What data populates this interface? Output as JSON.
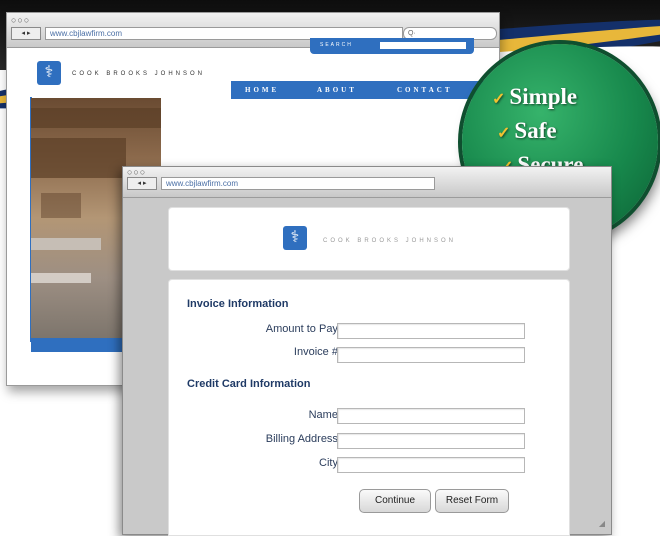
{
  "back_window": {
    "traffic": "○○○",
    "nav": "◂ ▸",
    "url": "www.cbjlawfirm.com",
    "search_placeholder": "Q·",
    "brand": "COOK BROOKS JOHNSON",
    "search_label": "SEARCH",
    "nav_items": [
      "HOME",
      "ABOUT",
      "CONTACT"
    ]
  },
  "badge": {
    "lines": [
      "Simple",
      "Safe",
      "Secure"
    ],
    "check": "✓"
  },
  "front_window": {
    "traffic": "○○○",
    "nav": "◂ ▸",
    "url": "www.cbjlawfirm.com",
    "brand": "COOK BROOKS JOHNSON",
    "logo_glyph": "⚕",
    "sections": {
      "invoice": {
        "title": "Invoice Information",
        "fields": [
          {
            "label": "Amount to Pay:",
            "value": ""
          },
          {
            "label": "Invoice #:",
            "value": ""
          }
        ]
      },
      "card": {
        "title": "Credit Card Information",
        "fields": [
          {
            "label": "Name:",
            "value": ""
          },
          {
            "label": "Billing Address:",
            "value": ""
          },
          {
            "label": "City:",
            "value": ""
          }
        ]
      }
    },
    "buttons": {
      "continue": "Continue",
      "reset": "Reset Form"
    }
  },
  "colors": {
    "brand_blue": "#2f6fbf",
    "badge_green": "#17884c",
    "check_gold": "#f2c230"
  }
}
